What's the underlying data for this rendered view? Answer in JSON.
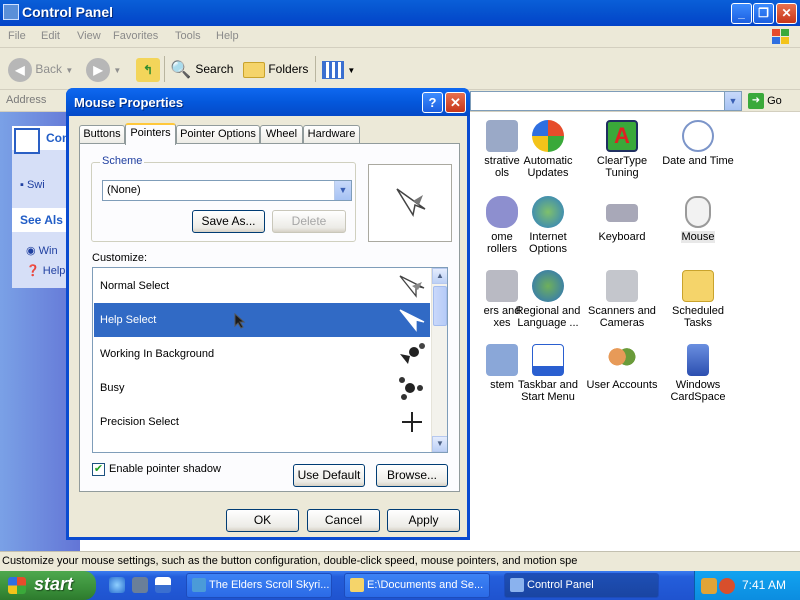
{
  "window": {
    "title": "Control Panel",
    "menu": [
      "File",
      "Edit",
      "View",
      "Favorites",
      "Tools",
      "Help"
    ],
    "toolbar": {
      "back": "Back",
      "search": "Search",
      "folders": "Folders"
    },
    "address_label": "Address",
    "go_label": "Go",
    "left": {
      "panel1_title": "Cont",
      "panel1_link": "Swi",
      "see_also": "See Als",
      "link_win": "Win",
      "link_help": "Help"
    },
    "status": "Customize your mouse settings, such as the button configuration, double-click speed, mouse pointers, and motion spe"
  },
  "icons": [
    {
      "label": "strative\nols"
    },
    {
      "label": "Automatic\nUpdates"
    },
    {
      "label": "ClearType\nTuning"
    },
    {
      "label": "Date and Time"
    },
    {
      "label": "ome\nrollers"
    },
    {
      "label": "Internet\nOptions"
    },
    {
      "label": "Keyboard"
    },
    {
      "label": "Mouse"
    },
    {
      "label": "ers and\nxes"
    },
    {
      "label": "Regional and\nLanguage ..."
    },
    {
      "label": "Scanners and\nCameras"
    },
    {
      "label": "Scheduled\nTasks"
    },
    {
      "label": "stem"
    },
    {
      "label": "Taskbar and\nStart Menu"
    },
    {
      "label": "User Accounts"
    },
    {
      "label": "Windows\nCardSpace"
    }
  ],
  "dialog": {
    "title": "Mouse Properties",
    "help_btn": "?",
    "tabs": [
      "Buttons",
      "Pointers",
      "Pointer Options",
      "Wheel",
      "Hardware"
    ],
    "active_tab": "Pointers",
    "scheme_label": "Scheme",
    "scheme_value": "(None)",
    "save_as": "Save As...",
    "delete": "Delete",
    "customize_label": "Customize:",
    "pointers": [
      {
        "name": "Normal Select"
      },
      {
        "name": "Help Select",
        "selected": true
      },
      {
        "name": "Working In Background"
      },
      {
        "name": "Busy"
      },
      {
        "name": "Precision Select"
      }
    ],
    "shadow_label": "Enable pointer shadow",
    "shadow_checked": true,
    "use_default": "Use Default",
    "browse": "Browse...",
    "ok": "OK",
    "cancel": "Cancel",
    "apply": "Apply"
  },
  "taskbar": {
    "start": "start",
    "tasks": [
      "The Elders Scroll Skyri...",
      "E:\\Documents and Se...",
      "Control Panel"
    ],
    "active_task": "Control Panel",
    "clock": "7:41 AM"
  },
  "colors": {
    "title_blue": "#0458dc",
    "selection": "#316ac5",
    "taskbar": "#245edb",
    "start_green": "#3a8f3a"
  }
}
